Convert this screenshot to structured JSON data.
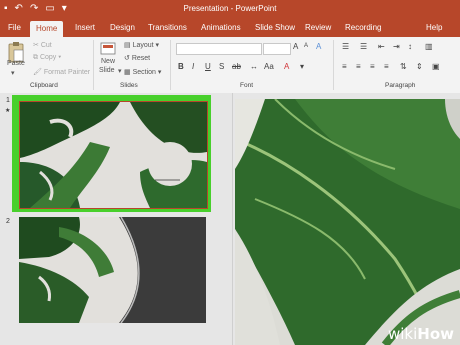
{
  "window": {
    "title": "Presentation - PowerPoint"
  },
  "qat": {
    "save": "▪",
    "undo": "↶",
    "redo": "↷",
    "present": "▭",
    "more": "▾"
  },
  "tabs": [
    "File",
    "Home",
    "Insert",
    "Design",
    "Transitions",
    "Animations",
    "Slide Show",
    "Review",
    "Recording",
    "Help"
  ],
  "ribbon": {
    "paste": "Paste",
    "cut": "Cut",
    "copy": "Copy",
    "format_painter": "Format Painter",
    "new_slide": "New",
    "new_slide_line2": "Slide",
    "layout": "Layout",
    "reset": "Reset",
    "section": "Section",
    "groups": {
      "clipboard": "Clipboard",
      "slides": "Slides",
      "font": "Font",
      "paragraph": "Paragraph"
    }
  },
  "slides": [
    {
      "number": "1"
    },
    {
      "number": "2"
    }
  ],
  "colors": {
    "accent": "#b7472a",
    "selection": "#48d02c",
    "leaf_dark": "#1e4a1e",
    "leaf_light": "#4e8f3a"
  },
  "watermark": {
    "part1": "wiki",
    "part2": "How"
  }
}
